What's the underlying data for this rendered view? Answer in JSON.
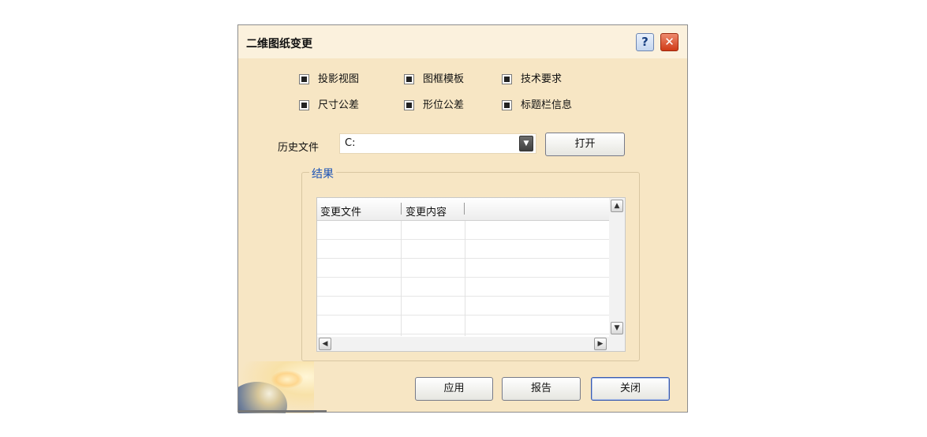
{
  "dialog": {
    "title": "二维图纸变更",
    "help_label": "?",
    "close_label": "✕"
  },
  "options": [
    {
      "label": "投影视图",
      "checked": true
    },
    {
      "label": "图框模板",
      "checked": true
    },
    {
      "label": "技术要求",
      "checked": true
    },
    {
      "label": "尺寸公差",
      "checked": true
    },
    {
      "label": "形位公差",
      "checked": true
    },
    {
      "label": "标题栏信息",
      "checked": true
    }
  ],
  "history": {
    "label": "历史文件",
    "value": "C:",
    "open_button": "打开"
  },
  "results": {
    "group_title": "结果",
    "columns": [
      "变更文件",
      "变更内容"
    ],
    "rows": []
  },
  "footer": {
    "apply": "应用",
    "report": "报告",
    "close": "关闭"
  }
}
